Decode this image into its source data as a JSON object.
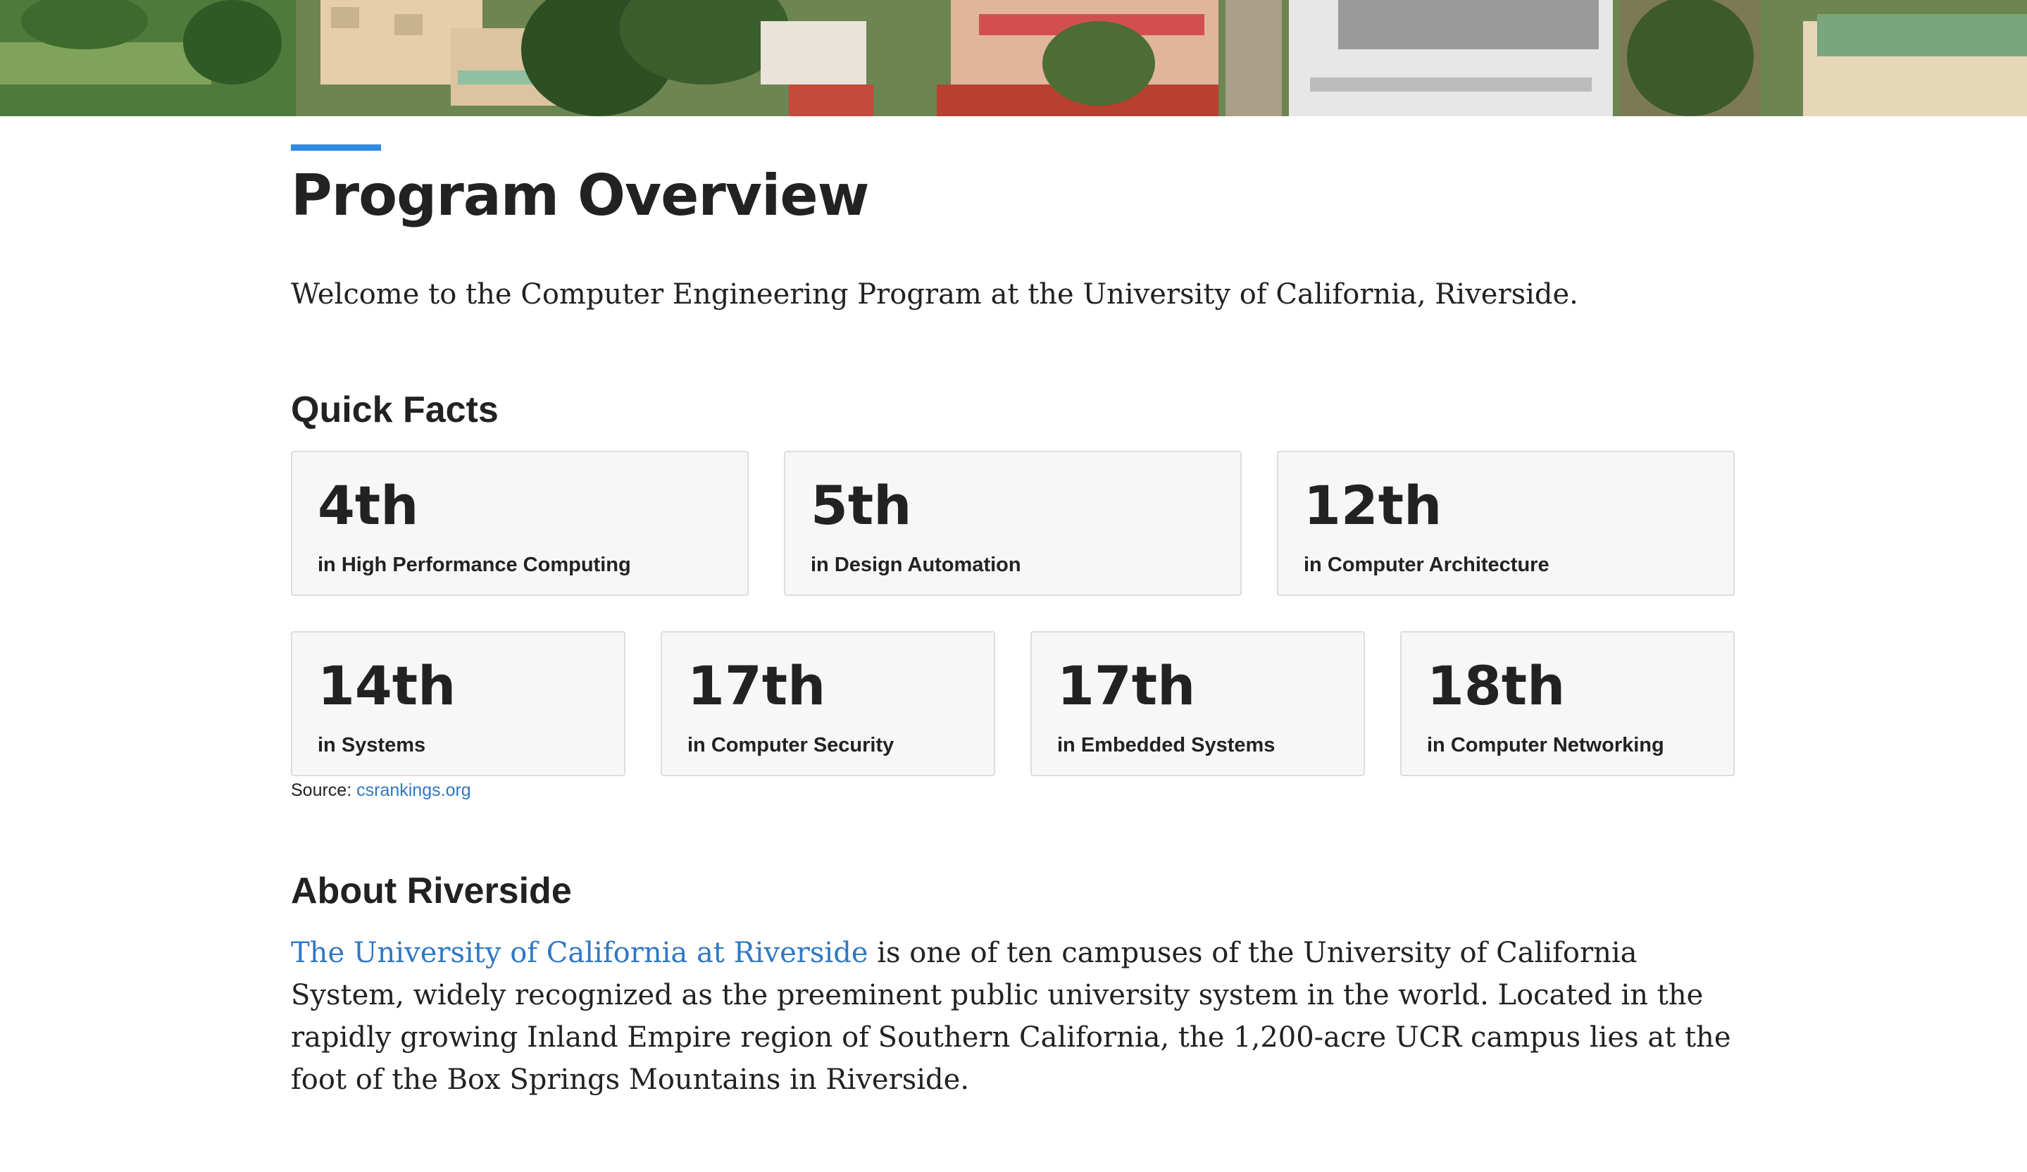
{
  "page": {
    "title": "Program Overview",
    "intro": "Welcome to the Computer Engineering Program at the University of California, Riverside."
  },
  "quick_facts": {
    "heading": "Quick Facts",
    "row1": [
      {
        "rank": "4th",
        "label": "in High Performance Computing"
      },
      {
        "rank": "5th",
        "label": "in Design Automation"
      },
      {
        "rank": "12th",
        "label": "in Computer Architecture"
      }
    ],
    "row2": [
      {
        "rank": "14th",
        "label": "in Systems"
      },
      {
        "rank": "17th",
        "label": "in Computer Security"
      },
      {
        "rank": "17th",
        "label": "in Embedded Systems"
      },
      {
        "rank": "18th",
        "label": "in Computer Networking"
      }
    ],
    "source_prefix": "Source:",
    "source_link": "csrankings.org"
  },
  "about": {
    "heading": "About Riverside",
    "link_text": "The University of California at Riverside",
    "body": " is one of ten campuses of the University of California System, widely recognized as the preeminent public university system in the world. Located in the rapidly growing Inland Empire region of Southern California, the 1,200-acre UCR campus lies at the foot of the Box Springs Mountains in Riverside."
  },
  "colors": {
    "accent": "#2f8ae0",
    "link": "#2f78c4",
    "card_bg": "#f7f7f7",
    "card_border": "#dddddd"
  }
}
